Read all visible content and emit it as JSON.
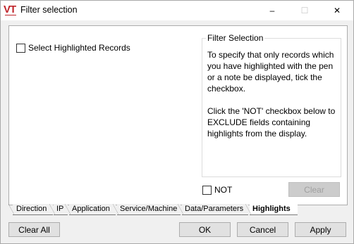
{
  "window": {
    "title": "Filter selection",
    "logo_text": "VT",
    "controls": {
      "minimize": "–",
      "maximize": "☐",
      "close": "✕"
    }
  },
  "panel": {
    "select_highlighted_label": "Select Highlighted Records",
    "groupbox_title": "Filter Selection",
    "groupbox_text": "To specify that only records which you have highlighted with the pen or a note be displayed, tick the checkbox.\n\nClick the 'NOT' checkbox below to EXCLUDE fields containing highlights from the display.",
    "not_label": "NOT",
    "clear_label": "Clear"
  },
  "tabs": [
    {
      "label": "Direction",
      "active": false
    },
    {
      "label": "IP",
      "active": false
    },
    {
      "label": "Application",
      "active": false
    },
    {
      "label": "Service/Machine",
      "active": false
    },
    {
      "label": "Data/Parameters",
      "active": false
    },
    {
      "label": "Highlights",
      "active": true
    }
  ],
  "footer": {
    "clear_all": "Clear All",
    "ok": "OK",
    "cancel": "Cancel",
    "apply": "Apply"
  }
}
